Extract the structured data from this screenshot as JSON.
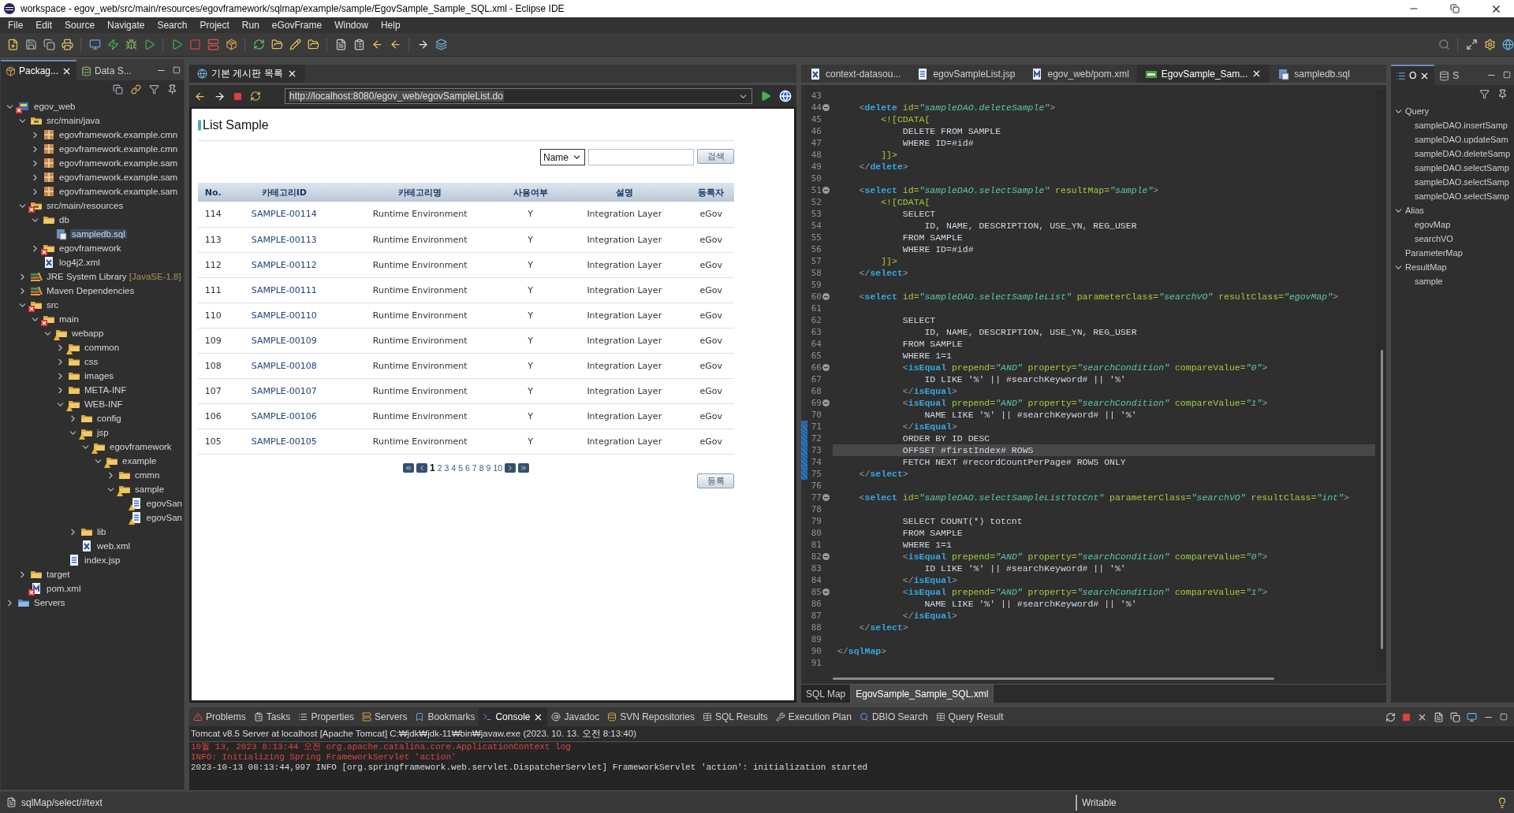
{
  "window": {
    "title": "workspace - egov_web/src/main/resources/egovframework/sqlmap/example/sample/EgovSample_Sample_SQL.xml - Eclipse IDE"
  },
  "menu": [
    "File",
    "Edit",
    "Source",
    "Navigate",
    "Search",
    "Project",
    "Run",
    "eGovFrame",
    "Window",
    "Help"
  ],
  "explorer": {
    "tabs": [
      {
        "label": "Packag...",
        "selected": true
      },
      {
        "label": "Data S...",
        "selected": false
      }
    ],
    "tree": [
      {
        "label": "egov_web",
        "kind": "project",
        "error": true,
        "warning": false,
        "expanded": true,
        "selected": false,
        "children": [
          {
            "label": "src/main/java",
            "kind": "srcfolder",
            "error": false,
            "warning": false,
            "expanded": true,
            "selected": false,
            "children": [
              {
                "label": "egovframework.example.cmn",
                "kind": "package",
                "error": false,
                "warning": false,
                "expanded": false,
                "selected": false
              },
              {
                "label": "egovframework.example.cmn",
                "kind": "package",
                "error": false,
                "warning": false,
                "expanded": false,
                "selected": false
              },
              {
                "label": "egovframework.example.sam",
                "kind": "package",
                "error": false,
                "warning": false,
                "expanded": false,
                "selected": false
              },
              {
                "label": "egovframework.example.sam",
                "kind": "package",
                "error": false,
                "warning": false,
                "expanded": false,
                "selected": false
              },
              {
                "label": "egovframework.example.sam",
                "kind": "package",
                "error": false,
                "warning": false,
                "expanded": false,
                "selected": false
              }
            ]
          },
          {
            "label": "src/main/resources",
            "kind": "srcfolder",
            "error": true,
            "warning": false,
            "expanded": true,
            "selected": false,
            "children": [
              {
                "label": "db",
                "kind": "folder",
                "error": false,
                "warning": false,
                "expanded": true,
                "selected": false,
                "children": [
                  {
                    "label": "sampledb.sql",
                    "kind": "sql",
                    "error": false,
                    "warning": false,
                    "selected": true
                  }
                ]
              },
              {
                "label": "egovframework",
                "kind": "folder",
                "error": true,
                "warning": false,
                "expanded": false,
                "selected": false
              },
              {
                "label": "log4j2.xml",
                "kind": "xml",
                "error": false,
                "warning": false,
                "selected": false
              }
            ]
          },
          {
            "label": "JRE System Library",
            "extra": "[JavaSE-1.8]",
            "kind": "library",
            "error": false,
            "warning": false,
            "expanded": false,
            "selected": false
          },
          {
            "label": "Maven Dependencies",
            "kind": "library",
            "error": false,
            "warning": false,
            "expanded": false,
            "selected": false
          },
          {
            "label": "src",
            "kind": "folder",
            "error": true,
            "warning": false,
            "expanded": true,
            "selected": false,
            "children": [
              {
                "label": "main",
                "kind": "folder",
                "error": true,
                "warning": false,
                "expanded": true,
                "selected": false,
                "children": [
                  {
                    "label": "webapp",
                    "kind": "folder",
                    "error": false,
                    "warning": true,
                    "expanded": true,
                    "selected": false,
                    "children": [
                      {
                        "label": "common",
                        "kind": "folder",
                        "error": false,
                        "warning": true,
                        "expanded": false,
                        "selected": false
                      },
                      {
                        "label": "css",
                        "kind": "folder",
                        "error": false,
                        "warning": false,
                        "expanded": false,
                        "selected": false
                      },
                      {
                        "label": "images",
                        "kind": "folder",
                        "error": false,
                        "warning": false,
                        "expanded": false,
                        "selected": false
                      },
                      {
                        "label": "META-INF",
                        "kind": "folder",
                        "error": false,
                        "warning": false,
                        "expanded": false,
                        "selected": false
                      },
                      {
                        "label": "WEB-INF",
                        "kind": "folder",
                        "error": false,
                        "warning": true,
                        "expanded": true,
                        "selected": false,
                        "children": [
                          {
                            "label": "config",
                            "kind": "folder",
                            "error": false,
                            "warning": false,
                            "expanded": false,
                            "selected": false
                          },
                          {
                            "label": "jsp",
                            "kind": "folder",
                            "error": false,
                            "warning": true,
                            "expanded": true,
                            "selected": false,
                            "children": [
                              {
                                "label": "egovframework",
                                "kind": "folder",
                                "error": false,
                                "warning": true,
                                "expanded": true,
                                "selected": false,
                                "children": [
                                  {
                                    "label": "example",
                                    "kind": "folder",
                                    "error": false,
                                    "warning": true,
                                    "expanded": true,
                                    "selected": false,
                                    "children": [
                                      {
                                        "label": "cmmn",
                                        "kind": "folder",
                                        "error": false,
                                        "warning": false,
                                        "expanded": false,
                                        "selected": false
                                      },
                                      {
                                        "label": "sample",
                                        "kind": "folder",
                                        "error": false,
                                        "warning": true,
                                        "expanded": true,
                                        "selected": false,
                                        "children": [
                                          {
                                            "label": "egovSan",
                                            "kind": "jsp",
                                            "error": false,
                                            "warning": true,
                                            "selected": false
                                          },
                                          {
                                            "label": "egovSan",
                                            "kind": "jsp",
                                            "error": false,
                                            "warning": true,
                                            "selected": false
                                          }
                                        ]
                                      }
                                    ]
                                  }
                                ]
                              }
                            ]
                          },
                          {
                            "label": "lib",
                            "kind": "folder",
                            "error": false,
                            "warning": false,
                            "expanded": false,
                            "selected": false
                          },
                          {
                            "label": "web.xml",
                            "kind": "xml",
                            "error": false,
                            "warning": false,
                            "selected": false
                          }
                        ]
                      },
                      {
                        "label": "index.jsp",
                        "kind": "jsp",
                        "error": false,
                        "warning": false,
                        "selected": false
                      }
                    ]
                  }
                ]
              }
            ]
          },
          {
            "label": "target",
            "kind": "folder",
            "error": false,
            "warning": false,
            "expanded": false,
            "selected": false
          },
          {
            "label": "pom.xml",
            "kind": "pom",
            "error": true,
            "warning": false,
            "selected": false
          }
        ]
      },
      {
        "label": "Servers",
        "kind": "servers",
        "error": false,
        "warning": false,
        "expanded": false,
        "selected": false
      }
    ]
  },
  "browser": {
    "tab": "기본 게시판 목록",
    "url": "http://localhost:8080/egov_web/egovSampleList.do",
    "page": {
      "title": "List Sample",
      "search_select": "Name",
      "search_button": "검색",
      "columns": [
        "No.",
        "카테고리ID",
        "카테고리명",
        "사용여부",
        "설명",
        "등록자"
      ],
      "rows": [
        [
          "114",
          "SAMPLE-00114",
          "Runtime Environment",
          "Y",
          "Integration Layer",
          "eGov"
        ],
        [
          "113",
          "SAMPLE-00113",
          "Runtime Environment",
          "Y",
          "Integration Layer",
          "eGov"
        ],
        [
          "112",
          "SAMPLE-00112",
          "Runtime Environment",
          "Y",
          "Integration Layer",
          "eGov"
        ],
        [
          "111",
          "SAMPLE-00111",
          "Runtime Environment",
          "Y",
          "Integration Layer",
          "eGov"
        ],
        [
          "110",
          "SAMPLE-00110",
          "Runtime Environment",
          "Y",
          "Integration Layer",
          "eGov"
        ],
        [
          "109",
          "SAMPLE-00109",
          "Runtime Environment",
          "Y",
          "Integration Layer",
          "eGov"
        ],
        [
          "108",
          "SAMPLE-00108",
          "Runtime Environment",
          "Y",
          "Integration Layer",
          "eGov"
        ],
        [
          "107",
          "SAMPLE-00107",
          "Runtime Environment",
          "Y",
          "Integration Layer",
          "eGov"
        ],
        [
          "106",
          "SAMPLE-00106",
          "Runtime Environment",
          "Y",
          "Integration Layer",
          "eGov"
        ],
        [
          "105",
          "SAMPLE-00105",
          "Runtime Environment",
          "Y",
          "Integration Layer",
          "eGov"
        ]
      ],
      "pages": [
        {
          "label": "1",
          "selected": true
        },
        {
          "label": "2",
          "selected": false
        },
        {
          "label": "3",
          "selected": false
        },
        {
          "label": "4",
          "selected": false
        },
        {
          "label": "5",
          "selected": false
        },
        {
          "label": "6",
          "selected": false
        },
        {
          "label": "7",
          "selected": false
        },
        {
          "label": "8",
          "selected": false
        },
        {
          "label": "9",
          "selected": false
        },
        {
          "label": "10",
          "selected": false
        }
      ],
      "register_button": "등록"
    }
  },
  "editor": {
    "tabs": [
      {
        "label": "context-datasou...",
        "kind": "xml",
        "selected": false
      },
      {
        "label": "egovSampleList.jsp",
        "kind": "jsp",
        "selected": false
      },
      {
        "label": "egov_web/pom.xml",
        "kind": "pom",
        "selected": false
      },
      {
        "label": "EgovSample_Sam...",
        "kind": "map",
        "selected": true
      },
      {
        "label": "sampledb.sql",
        "kind": "sql",
        "selected": false
      }
    ],
    "lines": [
      {
        "n": "43",
        "fold": false,
        "changed": false,
        "current": false
      },
      {
        "n": "44",
        "text": "    <delete id=\"sampleDAO.deleteSample\">",
        "fold": true,
        "changed": false,
        "current": false
      },
      {
        "n": "45",
        "text": "        <![CDATA[",
        "fold": false,
        "changed": false,
        "current": false
      },
      {
        "n": "46",
        "text": "            DELETE FROM SAMPLE",
        "fold": false,
        "changed": false,
        "current": false
      },
      {
        "n": "47",
        "text": "            WHERE ID=#id#",
        "fold": false,
        "changed": false,
        "current": false
      },
      {
        "n": "48",
        "text": "        ]]>",
        "fold": false,
        "changed": false,
        "current": false
      },
      {
        "n": "49",
        "text": "    </delete>",
        "fold": false,
        "changed": false,
        "current": false
      },
      {
        "n": "50",
        "fold": false,
        "changed": false,
        "current": false
      },
      {
        "n": "51",
        "text": "    <select id=\"sampleDAO.selectSample\" resultMap=\"sample\">",
        "fold": true,
        "changed": false,
        "current": false
      },
      {
        "n": "52",
        "text": "        <![CDATA[",
        "fold": false,
        "changed": false,
        "current": false
      },
      {
        "n": "53",
        "text": "            SELECT",
        "fold": false,
        "changed": false,
        "current": false
      },
      {
        "n": "54",
        "text": "                ID, NAME, DESCRIPTION, USE_YN, REG_USER",
        "fold": false,
        "changed": false,
        "current": false
      },
      {
        "n": "55",
        "text": "            FROM SAMPLE",
        "fold": false,
        "changed": false,
        "current": false
      },
      {
        "n": "56",
        "text": "            WHERE ID=#id#",
        "fold": false,
        "changed": false,
        "current": false
      },
      {
        "n": "57",
        "text": "        ]]>",
        "fold": false,
        "changed": false,
        "current": false
      },
      {
        "n": "58",
        "text": "    </select>",
        "fold": false,
        "changed": false,
        "current": false
      },
      {
        "n": "59",
        "fold": false,
        "changed": false,
        "current": false
      },
      {
        "n": "60",
        "text": "    <select id=\"sampleDAO.selectSampleList\" parameterClass=\"searchVO\" resultClass=\"egovMap\">",
        "fold": true,
        "changed": false,
        "current": false
      },
      {
        "n": "61",
        "fold": false,
        "changed": false,
        "current": false
      },
      {
        "n": "62",
        "text": "            SELECT",
        "fold": false,
        "changed": false,
        "current": false
      },
      {
        "n": "63",
        "text": "                ID, NAME, DESCRIPTION, USE_YN, REG_USER",
        "fold": false,
        "changed": false,
        "current": false
      },
      {
        "n": "64",
        "text": "            FROM SAMPLE",
        "fold": false,
        "changed": false,
        "current": false
      },
      {
        "n": "65",
        "text": "            WHERE 1=1",
        "fold": false,
        "changed": false,
        "current": false
      },
      {
        "n": "66",
        "text": "            <isEqual prepend=\"AND\" property=\"searchCondition\" compareValue=\"0\">",
        "fold": true,
        "changed": false,
        "current": false
      },
      {
        "n": "67",
        "text": "                ID LIKE '%' || #searchKeyword# || '%'",
        "fold": false,
        "changed": false,
        "current": false
      },
      {
        "n": "68",
        "text": "            </isEqual>",
        "fold": false,
        "changed": false,
        "current": false
      },
      {
        "n": "69",
        "text": "            <isEqual prepend=\"AND\" property=\"searchCondition\" compareValue=\"1\">",
        "fold": true,
        "changed": false,
        "current": false
      },
      {
        "n": "70",
        "text": "                NAME LIKE '%' || #searchKeyword# || '%'",
        "fold": false,
        "changed": false,
        "current": false
      },
      {
        "n": "71",
        "text": "            </isEqual>",
        "fold": false,
        "changed": true,
        "current": false
      },
      {
        "n": "72",
        "text": "            ORDER BY ID DESC",
        "fold": false,
        "changed": true,
        "current": false
      },
      {
        "n": "73",
        "text": "            OFFSET #firstIndex# ROWS",
        "fold": false,
        "changed": true,
        "current": true
      },
      {
        "n": "74",
        "text": "            FETCH NEXT #recordCountPerPage# ROWS ONLY",
        "fold": false,
        "changed": true,
        "current": false
      },
      {
        "n": "75",
        "text": "    </select>",
        "fold": false,
        "changed": true,
        "current": false
      },
      {
        "n": "76",
        "fold": false,
        "changed": false,
        "current": false
      },
      {
        "n": "77",
        "text": "    <select id=\"sampleDAO.selectSampleListTotCnt\" parameterClass=\"searchVO\" resultClass=\"int\">",
        "fold": true,
        "changed": false,
        "current": false
      },
      {
        "n": "78",
        "fold": false,
        "changed": false,
        "current": false
      },
      {
        "n": "79",
        "text": "            SELECT COUNT(*) totcnt",
        "fold": false,
        "changed": false,
        "current": false
      },
      {
        "n": "80",
        "text": "            FROM SAMPLE",
        "fold": false,
        "changed": false,
        "current": false
      },
      {
        "n": "81",
        "text": "            WHERE 1=1",
        "fold": false,
        "changed": false,
        "current": false
      },
      {
        "n": "82",
        "text": "            <isEqual prepend=\"AND\" property=\"searchCondition\" compareValue=\"0\">",
        "fold": true,
        "changed": false,
        "current": false
      },
      {
        "n": "83",
        "text": "                ID LIKE '%' || #searchKeyword# || '%'",
        "fold": false,
        "changed": false,
        "current": false
      },
      {
        "n": "84",
        "text": "            </isEqual>",
        "fold": false,
        "changed": false,
        "current": false
      },
      {
        "n": "85",
        "text": "            <isEqual prepend=\"AND\" property=\"searchCondition\" compareValue=\"1\">",
        "fold": true,
        "changed": false,
        "current": false
      },
      {
        "n": "86",
        "text": "                NAME LIKE '%' || #searchKeyword# || '%'",
        "fold": false,
        "changed": false,
        "current": false
      },
      {
        "n": "87",
        "text": "            </isEqual>",
        "fold": false,
        "changed": false,
        "current": false
      },
      {
        "n": "88",
        "text": "    </select>",
        "fold": false,
        "changed": false,
        "current": false
      },
      {
        "n": "89",
        "fold": false,
        "changed": false,
        "current": false
      },
      {
        "n": "90",
        "text": "</sqlMap>",
        "fold": false,
        "changed": false,
        "current": false
      },
      {
        "n": "91",
        "fold": false,
        "changed": false,
        "current": false
      }
    ],
    "bottom_tabs": [
      {
        "label": "SQL Map",
        "selected": false
      },
      {
        "label": "EgovSample_Sample_SQL.xml",
        "selected": true
      }
    ]
  },
  "outline": {
    "tabs": [
      {
        "label": "O",
        "selected": true
      },
      {
        "label": "S",
        "selected": false
      }
    ],
    "tree": [
      {
        "label": "Query",
        "expanded": true,
        "children": [
          {
            "label": "sampleDAO.insertSamp"
          },
          {
            "label": "sampleDAO.updateSam"
          },
          {
            "label": "sampleDAO.deleteSamp"
          },
          {
            "label": "sampleDAO.selectSamp"
          },
          {
            "label": "sampleDAO.selectSamp"
          },
          {
            "label": "sampleDAO.selectSamp"
          }
        ]
      },
      {
        "label": "Alias",
        "expanded": true,
        "children": [
          {
            "label": "egovMap"
          },
          {
            "label": "searchVO"
          }
        ]
      },
      {
        "label": "ParameterMap"
      },
      {
        "label": "ResultMap",
        "expanded": true,
        "children": [
          {
            "label": "sample"
          }
        ]
      }
    ]
  },
  "console": {
    "tabs": [
      {
        "label": "Problems",
        "selected": false
      },
      {
        "label": "Tasks",
        "selected": false
      },
      {
        "label": "Properties",
        "selected": false
      },
      {
        "label": "Servers",
        "selected": false
      },
      {
        "label": "Bookmarks",
        "selected": false
      },
      {
        "label": "Console",
        "selected": true
      },
      {
        "label": "Javadoc",
        "selected": false
      },
      {
        "label": "SVN Repositories",
        "selected": false
      },
      {
        "label": "SQL Results",
        "selected": false
      },
      {
        "label": "Execution Plan",
        "selected": false
      },
      {
        "label": "DBIO Search",
        "selected": false
      },
      {
        "label": "Query Result",
        "selected": false
      }
    ],
    "header": "Tomcat v8.5 Server at localhost [Apache Tomcat] C:₩jdk₩jdk-11₩bin₩javaw.exe  (2023. 10. 13. 오전 8:13:40)",
    "lines": [
      {
        "kind": "stderr",
        "text": "10월 13, 2023 8:13:44 오전 org.apache.catalina.core.ApplicationContext log"
      },
      {
        "kind": "stderr",
        "text": "INFO: Initializing Spring FrameworkServlet 'action'"
      },
      {
        "kind": "stdout",
        "text": "2023-10-13 08:13:44,997  INFO [org.springframework.web.servlet.DispatcherServlet] FrameworkServlet 'action': initialization started"
      }
    ]
  },
  "status_bar": {
    "path": "sqlMap/select/#text",
    "mode": "Writable"
  }
}
